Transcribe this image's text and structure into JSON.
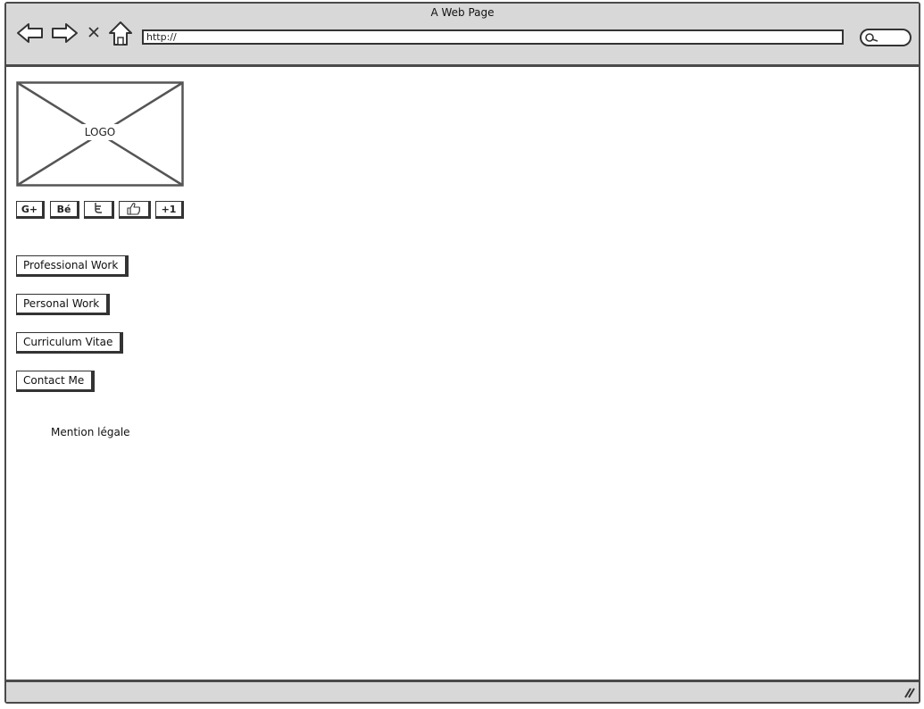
{
  "window": {
    "title": "A Web Page"
  },
  "browser": {
    "url": "http://",
    "back_icon": "arrow-left-icon",
    "forward_icon": "arrow-right-icon",
    "stop_icon": "close-icon",
    "home_icon": "home-icon",
    "search_icon": "search-icon"
  },
  "logo": {
    "label": "LOGO"
  },
  "social": {
    "googleplus": "G+",
    "behance": "Bé",
    "twitter_icon": "twitter-icon",
    "like_icon": "thumbs-up-icon",
    "plusone": "+1"
  },
  "menu": {
    "professional": "Professional Work",
    "personal": "Personal Work",
    "cv": "Curriculum Vitae",
    "contact": "Contact Me"
  },
  "footer": {
    "legal": "Mention légale"
  },
  "colors": {
    "chrome": "#d8d8d8",
    "stroke": "#333333",
    "page": "#ffffff"
  }
}
